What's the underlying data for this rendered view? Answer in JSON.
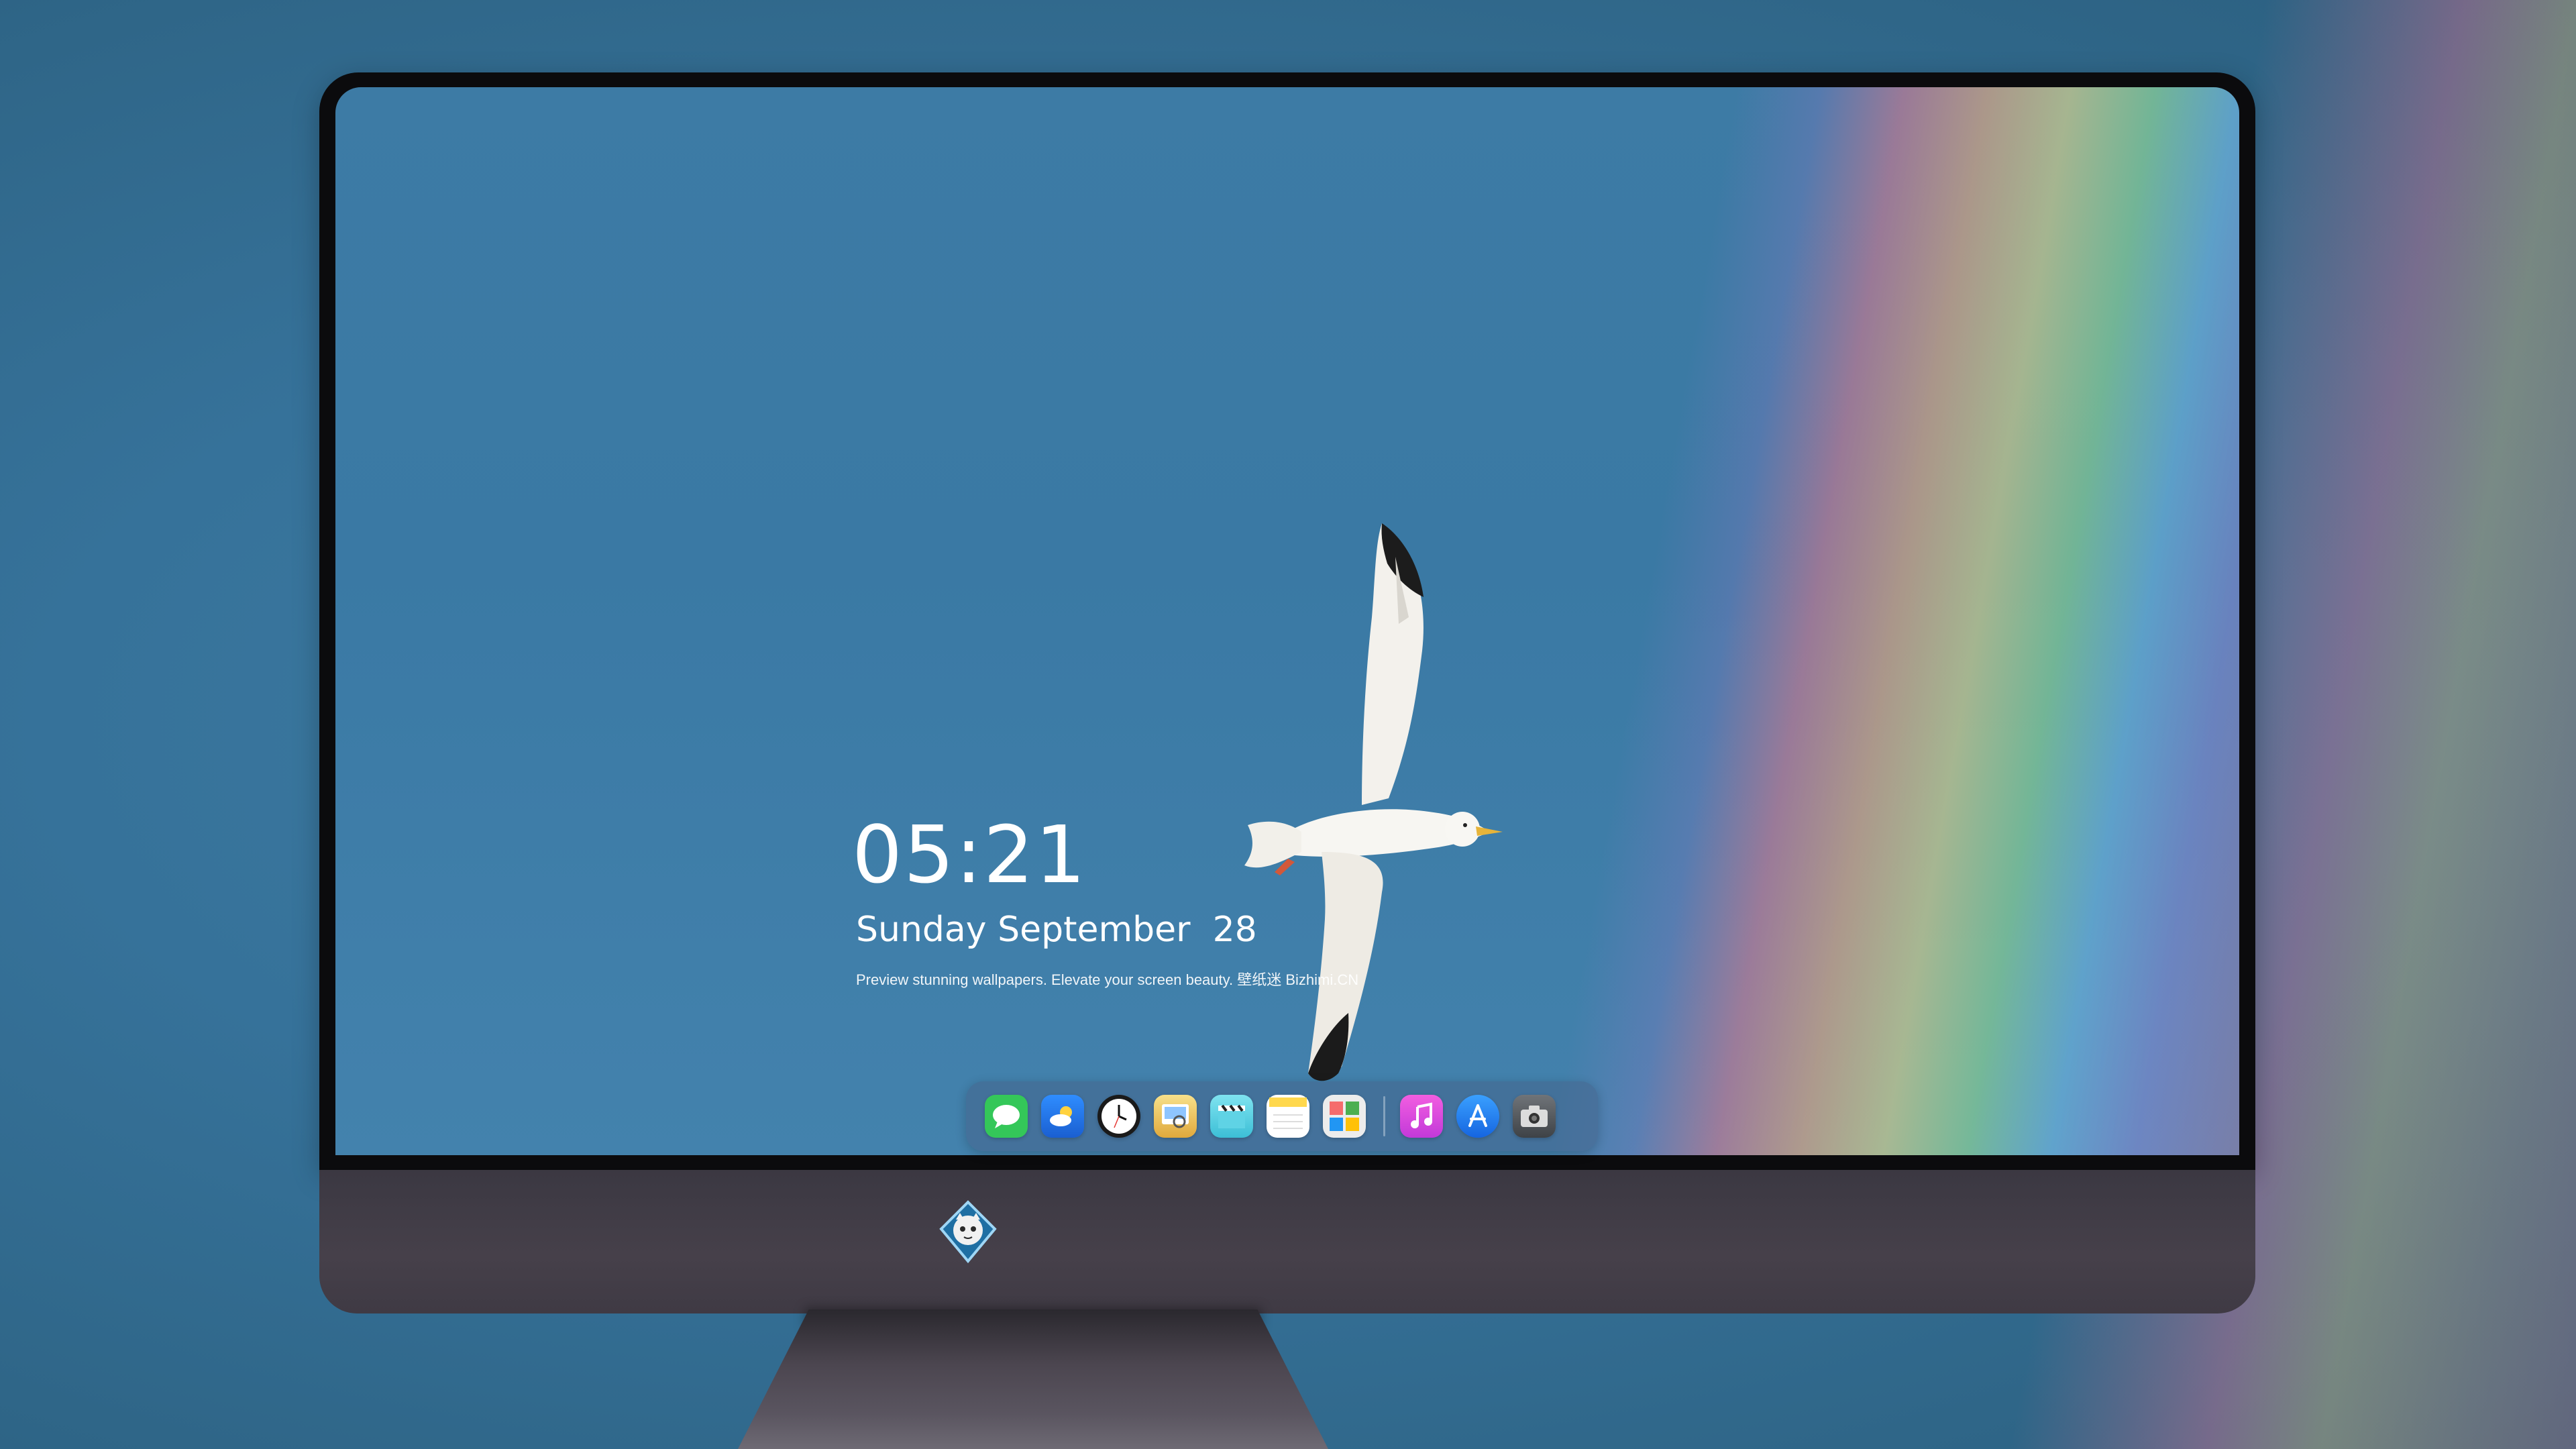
{
  "lockscreen": {
    "time": "05:21",
    "date": "Sunday September  28",
    "tagline": "Preview stunning wallpapers. Elevate your screen beauty. 壁纸迷 Bizhimi.CN"
  },
  "dock": {
    "apps": [
      {
        "name": "Messages",
        "icon": "messages-icon",
        "color": "#34c759"
      },
      {
        "name": "Weather",
        "icon": "weather-icon",
        "color": "#2d8cf0"
      },
      {
        "name": "Clock",
        "icon": "clock-icon",
        "color": "#ffffff"
      },
      {
        "name": "Preview",
        "icon": "preview-icon",
        "color": "#f2c94c"
      },
      {
        "name": "Clips",
        "icon": "clapper-icon",
        "color": "#5ad8e6"
      },
      {
        "name": "Notes",
        "icon": "notes-icon",
        "color": "#ffd84d"
      },
      {
        "name": "Photo Booth",
        "icon": "photos-icon",
        "color": "#e8e8e8"
      },
      {
        "name": "Music",
        "icon": "music-icon",
        "color": "#e94fd7"
      },
      {
        "name": "App Store",
        "icon": "appstore-icon",
        "color": "#1e88ff"
      },
      {
        "name": "Camera",
        "icon": "camera-icon",
        "color": "#555a60"
      }
    ]
  },
  "colors": {
    "sky": "#3a79a4",
    "bezel": "#0b0b0d",
    "chin": "#433e48"
  }
}
